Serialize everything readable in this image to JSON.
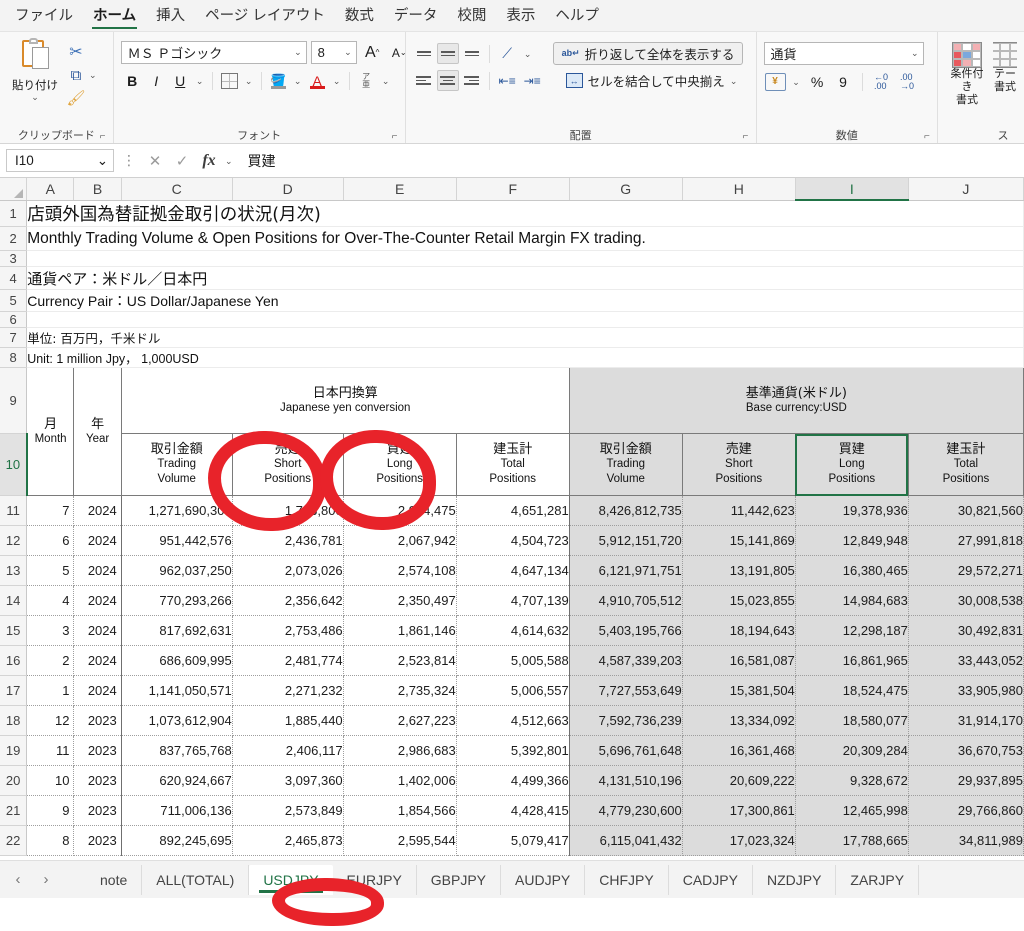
{
  "ribbon": {
    "tabs": [
      {
        "label": "ファイル",
        "active": false
      },
      {
        "label": "ホーム",
        "active": true
      },
      {
        "label": "挿入",
        "active": false
      },
      {
        "label": "ページ レイアウト",
        "active": false
      },
      {
        "label": "数式",
        "active": false
      },
      {
        "label": "データ",
        "active": false
      },
      {
        "label": "校閲",
        "active": false
      },
      {
        "label": "表示",
        "active": false
      },
      {
        "label": "ヘルプ",
        "active": false
      }
    ],
    "clipboard": {
      "paste_label": "貼り付け",
      "group_label": "クリップボード"
    },
    "font": {
      "font_name": "ＭＳ Ｐゴシック",
      "font_size": "8",
      "grow_label": "A",
      "shrink_label": "A",
      "bold_label": "B",
      "italic_label": "I",
      "underline_label": "U",
      "phonetic_top": "ア",
      "phonetic_bottom": "亜",
      "group_label": "フォント"
    },
    "alignment": {
      "wrap_label": "折り返して全体を表示する",
      "merge_label": "セルを結合して中央揃え",
      "group_label": "配置"
    },
    "number": {
      "format": "通貨",
      "percent_label": "%",
      "comma_label": "9",
      "group_label": "数値"
    },
    "styles": {
      "conditional_label": "条件付き\n書式",
      "conditional_line1": "条件付き",
      "conditional_line2": "書式",
      "table_line1": "テー",
      "table_line2": "書式",
      "group_label": "ス"
    }
  },
  "formula_bar": {
    "name_box": "I10",
    "cancel_icon": "✕",
    "enter_icon": "✓",
    "fx_icon": "fx",
    "content": "買建"
  },
  "grid": {
    "columns": [
      "A",
      "B",
      "C",
      "D",
      "E",
      "F",
      "G",
      "H",
      "I",
      "J"
    ],
    "selected_column": "I",
    "selected_row": "10",
    "row_numbers": [
      "1",
      "2",
      "3",
      "4",
      "5",
      "6",
      "7",
      "8",
      "9",
      "10",
      "11",
      "12",
      "13",
      "14",
      "15",
      "16",
      "17",
      "18",
      "19",
      "20",
      "21",
      "22"
    ],
    "titles": {
      "title_jp": "店頭外国為替証拠金取引の状況(月次)",
      "title_en": "Monthly Trading Volume & Open Positions for Over-The-Counter Retail Margin FX trading.",
      "pair_jp": "通貨ペア：米ドル／日本円",
      "pair_en": "Currency Pair：US Dollar/Japanese Yen",
      "unit_jp": "単位: 百万円，千米ドル",
      "unit_en": "Unit: 1 million Jpy， 1,000USD"
    },
    "header": {
      "month_jp": "月",
      "month_en": "Month",
      "year_jp": "年",
      "year_en": "Year",
      "group_jpy_jp": "日本円換算",
      "group_jpy_en": "Japanese yen conversion",
      "group_usd_jp": "基準通貨(米ドル)",
      "group_usd_en": "Base currency:USD",
      "cols": [
        {
          "jp": "取引金額",
          "en1": "Trading",
          "en2": "Volume"
        },
        {
          "jp": "売建",
          "en1": "Short",
          "en2": "Positions"
        },
        {
          "jp": "買建",
          "en1": "Long",
          "en2": "Positions"
        },
        {
          "jp": "建玉計",
          "en1": "Total",
          "en2": "Positions"
        }
      ]
    },
    "rows": [
      {
        "row": "11",
        "month": "7",
        "year": "2024",
        "jpy_volume": "1,271,690,309",
        "jpy_short": "1,726,800",
        "jpy_long": "2,924,475",
        "jpy_total": "4,651,281",
        "usd_volume": "8,426,812,735",
        "usd_short": "11,442,623",
        "usd_long": "19,378,936",
        "usd_total": "30,821,560"
      },
      {
        "row": "12",
        "month": "6",
        "year": "2024",
        "jpy_volume": "951,442,576",
        "jpy_short": "2,436,781",
        "jpy_long": "2,067,942",
        "jpy_total": "4,504,723",
        "usd_volume": "5,912,151,720",
        "usd_short": "15,141,869",
        "usd_long": "12,849,948",
        "usd_total": "27,991,818"
      },
      {
        "row": "13",
        "month": "5",
        "year": "2024",
        "jpy_volume": "962,037,250",
        "jpy_short": "2,073,026",
        "jpy_long": "2,574,108",
        "jpy_total": "4,647,134",
        "usd_volume": "6,121,971,751",
        "usd_short": "13,191,805",
        "usd_long": "16,380,465",
        "usd_total": "29,572,271"
      },
      {
        "row": "14",
        "month": "4",
        "year": "2024",
        "jpy_volume": "770,293,266",
        "jpy_short": "2,356,642",
        "jpy_long": "2,350,497",
        "jpy_total": "4,707,139",
        "usd_volume": "4,910,705,512",
        "usd_short": "15,023,855",
        "usd_long": "14,984,683",
        "usd_total": "30,008,538"
      },
      {
        "row": "15",
        "month": "3",
        "year": "2024",
        "jpy_volume": "817,692,631",
        "jpy_short": "2,753,486",
        "jpy_long": "1,861,146",
        "jpy_total": "4,614,632",
        "usd_volume": "5,403,195,766",
        "usd_short": "18,194,643",
        "usd_long": "12,298,187",
        "usd_total": "30,492,831"
      },
      {
        "row": "16",
        "month": "2",
        "year": "2024",
        "jpy_volume": "686,609,995",
        "jpy_short": "2,481,774",
        "jpy_long": "2,523,814",
        "jpy_total": "5,005,588",
        "usd_volume": "4,587,339,203",
        "usd_short": "16,581,087",
        "usd_long": "16,861,965",
        "usd_total": "33,443,052"
      },
      {
        "row": "17",
        "month": "1",
        "year": "2024",
        "jpy_volume": "1,141,050,571",
        "jpy_short": "2,271,232",
        "jpy_long": "2,735,324",
        "jpy_total": "5,006,557",
        "usd_volume": "7,727,553,649",
        "usd_short": "15,381,504",
        "usd_long": "18,524,475",
        "usd_total": "33,905,980"
      },
      {
        "row": "18",
        "month": "12",
        "year": "2023",
        "jpy_volume": "1,073,612,904",
        "jpy_short": "1,885,440",
        "jpy_long": "2,627,223",
        "jpy_total": "4,512,663",
        "usd_volume": "7,592,736,239",
        "usd_short": "13,334,092",
        "usd_long": "18,580,077",
        "usd_total": "31,914,170"
      },
      {
        "row": "19",
        "month": "11",
        "year": "2023",
        "jpy_volume": "837,765,768",
        "jpy_short": "2,406,117",
        "jpy_long": "2,986,683",
        "jpy_total": "5,392,801",
        "usd_volume": "5,696,761,648",
        "usd_short": "16,361,468",
        "usd_long": "20,309,284",
        "usd_total": "36,670,753"
      },
      {
        "row": "20",
        "month": "10",
        "year": "2023",
        "jpy_volume": "620,924,667",
        "jpy_short": "3,097,360",
        "jpy_long": "1,402,006",
        "jpy_total": "4,499,366",
        "usd_volume": "4,131,510,196",
        "usd_short": "20,609,222",
        "usd_long": "9,328,672",
        "usd_total": "29,937,895"
      },
      {
        "row": "21",
        "month": "9",
        "year": "2023",
        "jpy_volume": "711,006,136",
        "jpy_short": "2,573,849",
        "jpy_long": "1,854,566",
        "jpy_total": "4,428,415",
        "usd_volume": "4,779,230,600",
        "usd_short": "17,300,861",
        "usd_long": "12,465,998",
        "usd_total": "29,766,860"
      },
      {
        "row": "22",
        "month": "8",
        "year": "2023",
        "jpy_volume": "892,245,695",
        "jpy_short": "2,465,873",
        "jpy_long": "2,595,544",
        "jpy_total": "5,079,417",
        "usd_volume": "6,115,041,432",
        "usd_short": "17,023,324",
        "usd_long": "17,788,665",
        "usd_total": "34,811,989"
      }
    ]
  },
  "sheet_tabs": {
    "prev_icon": "‹",
    "next_icon": "›",
    "tabs": [
      {
        "label": "note",
        "active": false
      },
      {
        "label": "ALL(TOTAL)",
        "active": false
      },
      {
        "label": "USDJPY",
        "active": true
      },
      {
        "label": "EURJPY",
        "active": false
      },
      {
        "label": "GBPJPY",
        "active": false
      },
      {
        "label": "AUDJPY",
        "active": false
      },
      {
        "label": "CHFJPY",
        "active": false
      },
      {
        "label": "CADJPY",
        "active": false
      },
      {
        "label": "NZDJPY",
        "active": false
      },
      {
        "label": "ZARJPY",
        "active": false
      }
    ]
  },
  "annotations": {
    "marker_color": "#e8232a",
    "circled_items": [
      "jpy-short-header",
      "jpy-long-header",
      "sheet-tab-usdjpy"
    ]
  }
}
